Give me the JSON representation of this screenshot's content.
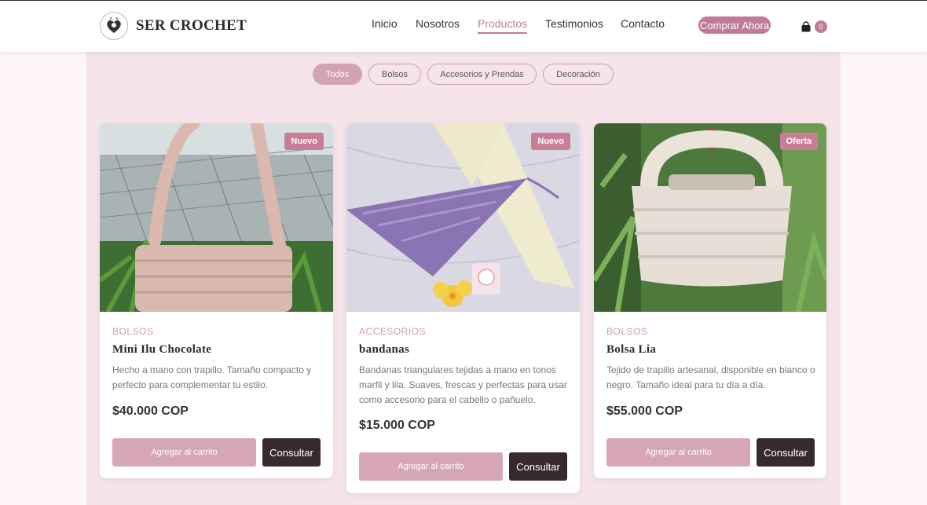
{
  "brand": {
    "name": "SER CROCHET",
    "logo_icon": "heart-yarn-logo-icon"
  },
  "nav": {
    "items": [
      {
        "label": "Inicio",
        "active": false
      },
      {
        "label": "Nosotros",
        "active": false
      },
      {
        "label": "Productos",
        "active": true
      },
      {
        "label": "Testimonios",
        "active": false
      },
      {
        "label": "Contacto",
        "active": false
      }
    ],
    "buy_label": "Comprar Ahora",
    "cart_icon": "shopping-bag-icon",
    "cart_count": "0"
  },
  "filters": [
    {
      "label": "Todos",
      "active": true
    },
    {
      "label": "Bolsos",
      "active": false
    },
    {
      "label": "Accesorios y Prendas",
      "active": false
    },
    {
      "label": "Decoración",
      "active": false
    }
  ],
  "products": [
    {
      "badge": "Nuevo",
      "category": "BOLSOS",
      "title": "Mini Ilu Chocolate",
      "description": "Hecho a mano con trapillo. Tamaño compacto y perfecto para complementar tu estilo.",
      "price": "$40.000 COP",
      "add_label": "Agregar al carrito",
      "ask_label": "Consultar"
    },
    {
      "badge": "Nuevo",
      "category": "ACCESORIOS",
      "title": "bandanas",
      "description": "Bandanas triangulares tejidas a mano en tonos marfil y lila. Suaves, frescas y perfectas para usar como accesorio para el cabello o pañuelo.",
      "price": "$15.000 COP",
      "add_label": "Agregar al carrito",
      "ask_label": "Consultar"
    },
    {
      "badge": "Oferta",
      "category": "BOLSOS",
      "title": "Bolsa Lia",
      "description": "Tejido de trapillo artesanal, disponible en blanco o negro. Tamaño ideal para tu día a día.",
      "price": "$55.000 COP",
      "add_label": "Agregar al carrito",
      "ask_label": "Consultar"
    }
  ],
  "colors": {
    "accent": "#c17a97",
    "panel": "#f6e4eb",
    "dark_button": "#362a2d"
  }
}
